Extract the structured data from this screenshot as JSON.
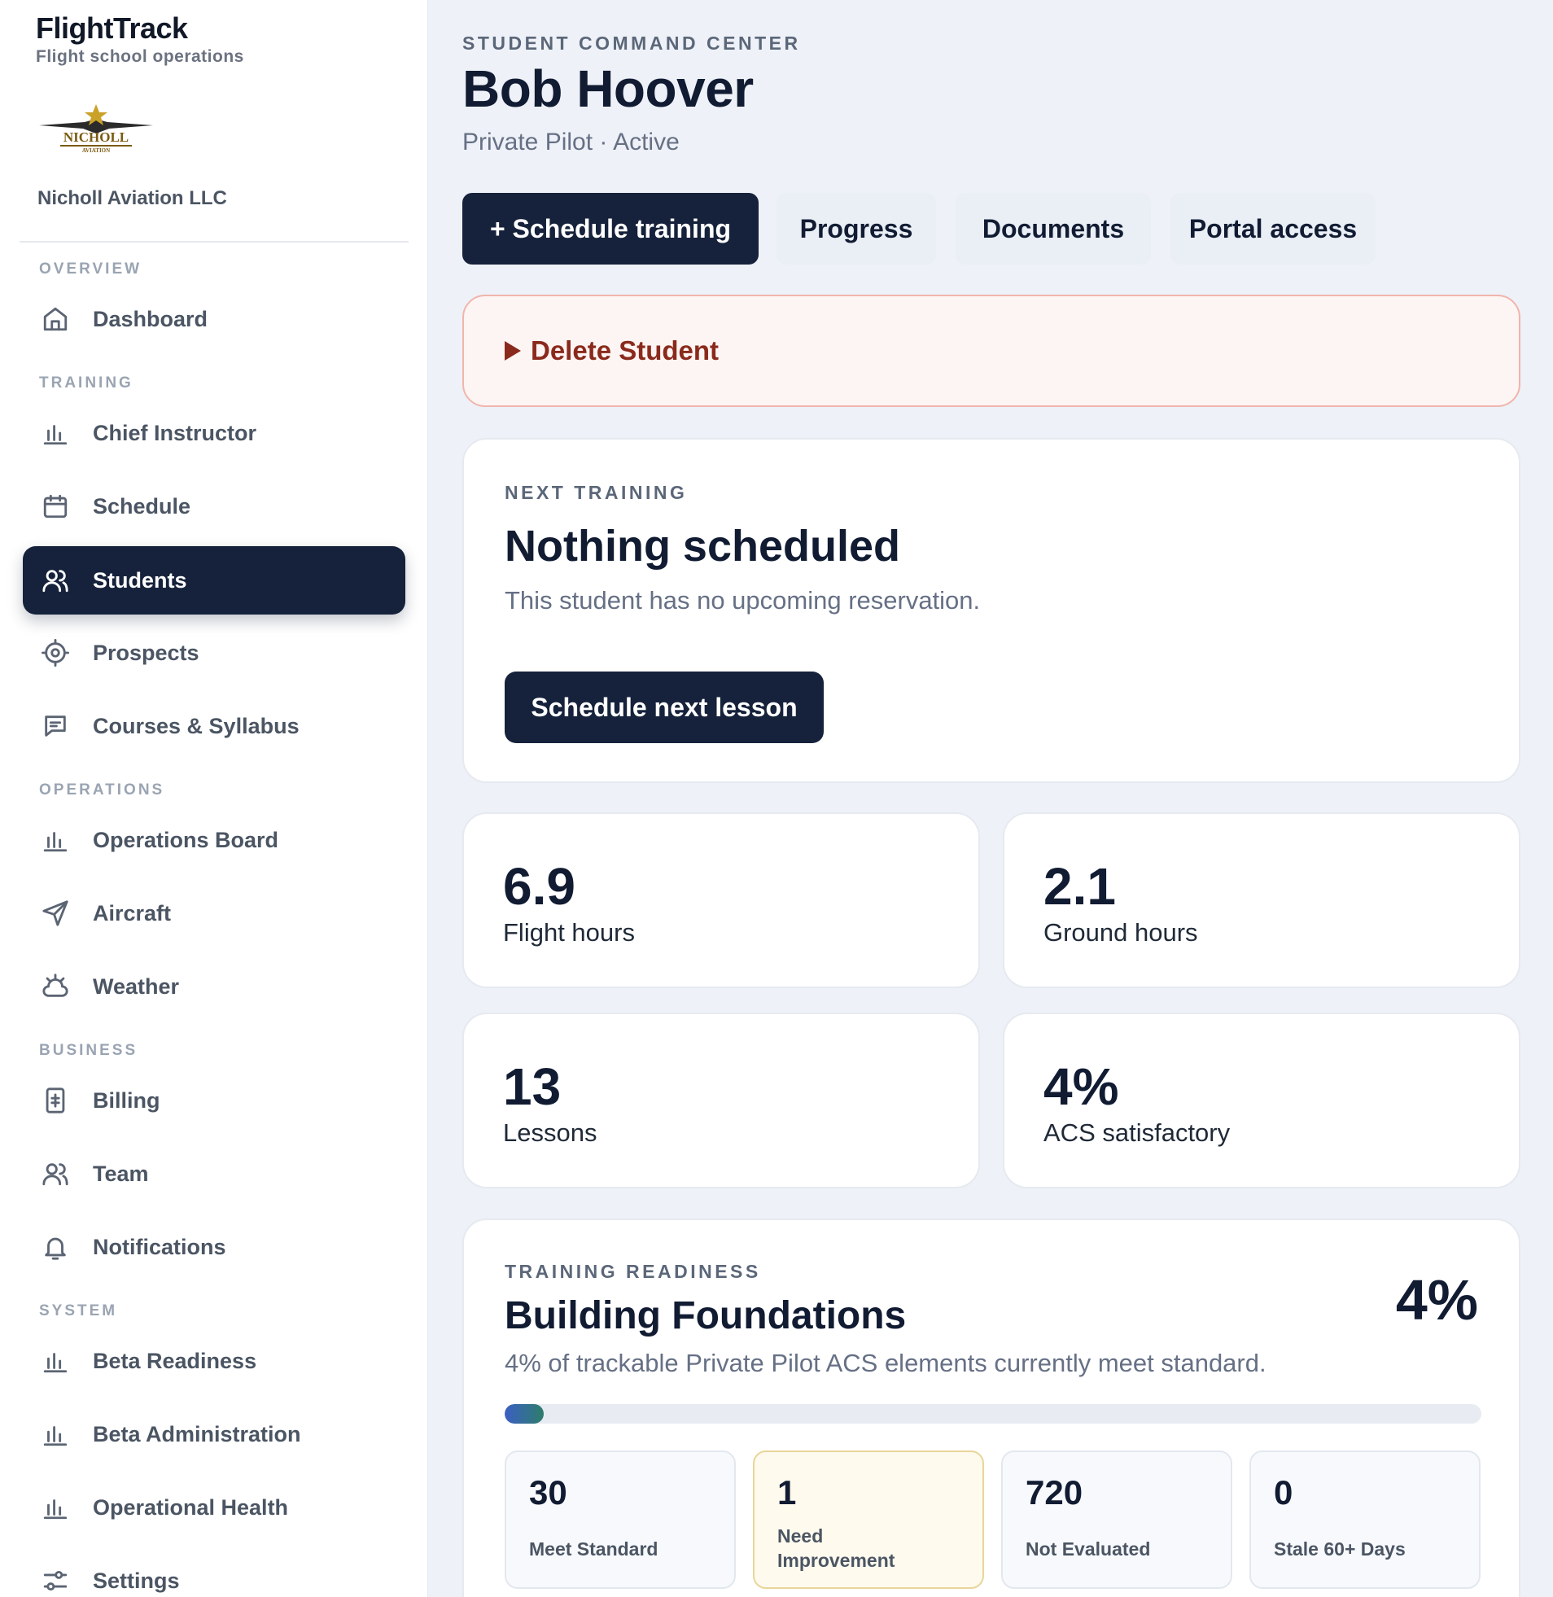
{
  "brand": {
    "title": "FlightTrack",
    "subtitle": "Flight school operations",
    "org_name": "Nicholl Aviation LLC",
    "logo_text": "NICHOLL",
    "logo_subtext": "AVIATION"
  },
  "sidebar": {
    "sections": [
      {
        "label": "OVERVIEW"
      },
      {
        "label": "TRAINING"
      },
      {
        "label": "OPERATIONS"
      },
      {
        "label": "BUSINESS"
      },
      {
        "label": "SYSTEM"
      }
    ],
    "items": [
      {
        "label": "Dashboard",
        "icon": "home-icon"
      },
      {
        "label": "Chief Instructor",
        "icon": "bar-chart-icon"
      },
      {
        "label": "Schedule",
        "icon": "calendar-icon"
      },
      {
        "label": "Students",
        "icon": "users-icon",
        "active": true
      },
      {
        "label": "Prospects",
        "icon": "target-icon"
      },
      {
        "label": "Courses & Syllabus",
        "icon": "message-square-icon"
      },
      {
        "label": "Operations Board",
        "icon": "bar-chart-icon"
      },
      {
        "label": "Aircraft",
        "icon": "send-icon"
      },
      {
        "label": "Weather",
        "icon": "cloud-sun-icon"
      },
      {
        "label": "Billing",
        "icon": "receipt-icon"
      },
      {
        "label": "Team",
        "icon": "users-icon"
      },
      {
        "label": "Notifications",
        "icon": "bell-icon"
      },
      {
        "label": "Beta Readiness",
        "icon": "bar-chart-icon"
      },
      {
        "label": "Beta Administration",
        "icon": "bar-chart-icon"
      },
      {
        "label": "Operational Health",
        "icon": "bar-chart-icon"
      },
      {
        "label": "Settings",
        "icon": "sliders-icon"
      }
    ]
  },
  "header": {
    "eyebrow": "STUDENT COMMAND CENTER",
    "title": "Bob Hoover",
    "subtitle": "Private Pilot · Active"
  },
  "actions": {
    "schedule_training": "+ Schedule training",
    "progress": "Progress",
    "documents": "Documents",
    "portal_access": "Portal access"
  },
  "danger": {
    "label": "Delete Student",
    "color": "#8a2a1c"
  },
  "next_training": {
    "eyebrow": "NEXT TRAINING",
    "title": "Nothing scheduled",
    "text": "This student has no upcoming reservation.",
    "button": "Schedule next lesson"
  },
  "stats": [
    {
      "value": "6.9",
      "label": "Flight hours"
    },
    {
      "value": "2.1",
      "label": "Ground hours"
    },
    {
      "value": "13",
      "label": "Lessons"
    },
    {
      "value": "4%",
      "label": "ACS satisfactory"
    }
  ],
  "readiness": {
    "eyebrow": "TRAINING READINESS",
    "title": "Building Foundations",
    "percent": "4%",
    "progress_fraction": 0.04,
    "description": "4% of trackable Private Pilot ACS elements currently meet standard.",
    "breakdown": [
      {
        "value": "30",
        "label": "Meet Standard"
      },
      {
        "value": "1",
        "label": "Need Improvement",
        "highlight": true
      },
      {
        "value": "720",
        "label": "Not Evaluated"
      },
      {
        "value": "0",
        "label": "Stale 60+ Days"
      }
    ]
  },
  "colors": {
    "primary": "#16223b",
    "background": "#eef1f7",
    "danger_bg": "#fdf5f3"
  }
}
